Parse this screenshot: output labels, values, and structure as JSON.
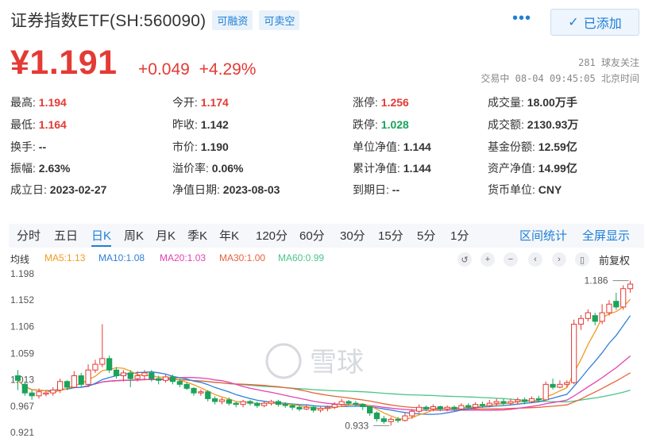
{
  "header": {
    "title": "证券指数ETF(SH:560090)",
    "tag_margin": "可融资",
    "tag_short": "可卖空",
    "more_icon": "more-dots-icon",
    "added_label": "已添加",
    "added_icon": "check-icon"
  },
  "quote": {
    "price": "¥1.191",
    "change": "+0.049",
    "change_pct": "+4.29%",
    "followers": "281 球友关注",
    "status": "交易中 08-04 09:45:05 北京时间",
    "up_color": "#e43a35",
    "down_color": "#1aa35a"
  },
  "stats": [
    {
      "k": "最高:",
      "v": "1.194",
      "c": "red"
    },
    {
      "k": "今开:",
      "v": "1.174",
      "c": "red"
    },
    {
      "k": "涨停:",
      "v": "1.256",
      "c": "red"
    },
    {
      "k": "成交量:",
      "v": "18.00万手",
      "c": ""
    },
    {
      "k": "最低:",
      "v": "1.164",
      "c": "red"
    },
    {
      "k": "昨收:",
      "v": "1.142",
      "c": ""
    },
    {
      "k": "跌停:",
      "v": "1.028",
      "c": "green"
    },
    {
      "k": "成交额:",
      "v": "2130.93万",
      "c": ""
    },
    {
      "k": "换手:",
      "v": "--",
      "c": ""
    },
    {
      "k": "市价:",
      "v": "1.190",
      "c": ""
    },
    {
      "k": "单位净值:",
      "v": "1.144",
      "c": ""
    },
    {
      "k": "基金份额:",
      "v": "12.59亿",
      "c": ""
    },
    {
      "k": "振幅:",
      "v": "2.63%",
      "c": ""
    },
    {
      "k": "溢价率:",
      "v": "0.06%",
      "c": ""
    },
    {
      "k": "累计净值:",
      "v": "1.144",
      "c": ""
    },
    {
      "k": "资产净值:",
      "v": "14.99亿",
      "c": ""
    },
    {
      "k": "成立日:",
      "v": "2023-02-27",
      "c": ""
    },
    {
      "k": "净值日期:",
      "v": "2023-08-03",
      "c": ""
    },
    {
      "k": "到期日:",
      "v": "--",
      "c": ""
    },
    {
      "k": "货币单位:",
      "v": "CNY",
      "c": ""
    }
  ],
  "tabs": [
    "分时",
    "五日",
    "日K",
    "周K",
    "月K",
    "季K",
    "年K",
    "120分",
    "60分",
    "30分",
    "15分",
    "5分",
    "1分"
  ],
  "active_tab": "日K",
  "tab_links": [
    "区间统计",
    "全屏显示"
  ],
  "ma_legend": [
    {
      "label": "均线",
      "color": "#333333"
    },
    {
      "label": "MA5:1.13",
      "color": "#f29a1f"
    },
    {
      "label": "MA10:1.08",
      "color": "#2f7fd8"
    },
    {
      "label": "MA20:1.03",
      "color": "#e443b0"
    },
    {
      "label": "MA30:1.00",
      "color": "#e8623a"
    },
    {
      "label": "MA60:0.99",
      "color": "#4cc48a"
    }
  ],
  "controls": [
    "undo-icon",
    "zoom-in-icon",
    "zoom-out-icon",
    "prev-icon",
    "next-icon",
    "candle-icon"
  ],
  "adjust_label": "前复权",
  "watermark": "雪球",
  "chart_data": {
    "type": "candlestick",
    "y_ticks": [
      "1.198",
      "1.152",
      "1.106",
      "1.059",
      "1.013",
      "0.967",
      "0.921"
    ],
    "ylim": [
      0.921,
      1.198
    ],
    "max_label": "1.186",
    "min_label": "0.933",
    "candles": [
      [
        1.02,
        1.012,
        1.03,
        0.995
      ],
      [
        1.005,
        0.99,
        1.01,
        0.985
      ],
      [
        0.99,
        0.985,
        0.995,
        0.978
      ],
      [
        0.985,
        0.992,
        0.998,
        0.98
      ],
      [
        0.988,
        0.99,
        0.995,
        0.984
      ],
      [
        0.99,
        0.995,
        1.0,
        0.985
      ],
      [
        0.995,
        1.01,
        1.015,
        0.99
      ],
      [
        1.01,
        1.0,
        1.012,
        0.995
      ],
      [
        1.0,
        1.02,
        1.028,
        0.998
      ],
      [
        1.02,
        1.005,
        1.025,
        1.0
      ],
      [
        1.005,
        1.03,
        1.04,
        1.0
      ],
      [
        1.03,
        1.04,
        1.048,
        1.025
      ],
      [
        1.04,
        1.05,
        1.11,
        1.035
      ],
      [
        1.05,
        1.03,
        1.055,
        1.025
      ],
      [
        1.03,
        1.02,
        1.035,
        1.015
      ],
      [
        1.02,
        1.025,
        1.03,
        1.01
      ],
      [
        1.025,
        1.015,
        1.03,
        1.0
      ],
      [
        1.015,
        1.02,
        1.028,
        1.01
      ],
      [
        1.02,
        1.025,
        1.03,
        1.012
      ],
      [
        1.025,
        1.015,
        1.03,
        1.01
      ],
      [
        1.015,
        1.012,
        1.02,
        1.005
      ],
      [
        1.012,
        1.018,
        1.022,
        1.008
      ],
      [
        1.018,
        1.01,
        1.022,
        1.005
      ],
      [
        1.01,
        1.005,
        1.015,
        1.0
      ],
      [
        1.005,
        0.998,
        1.008,
        0.995
      ],
      [
        0.998,
        0.99,
        1.0,
        0.985
      ],
      [
        0.99,
        0.992,
        0.996,
        0.985
      ],
      [
        0.992,
        0.98,
        0.995,
        0.975
      ],
      [
        0.98,
        0.975,
        0.984,
        0.97
      ],
      [
        0.975,
        0.978,
        0.982,
        0.97
      ],
      [
        0.978,
        0.972,
        0.982,
        0.968
      ],
      [
        0.972,
        0.97,
        0.975,
        0.965
      ],
      [
        0.97,
        0.975,
        0.978,
        0.965
      ],
      [
        0.975,
        0.972,
        0.978,
        0.968
      ],
      [
        0.972,
        0.968,
        0.975,
        0.964
      ],
      [
        0.968,
        0.972,
        0.976,
        0.965
      ],
      [
        0.972,
        0.975,
        0.978,
        0.968
      ],
      [
        0.975,
        0.97,
        0.978,
        0.966
      ],
      [
        0.97,
        0.968,
        0.974,
        0.964
      ],
      [
        0.968,
        0.965,
        0.972,
        0.96
      ],
      [
        0.965,
        0.962,
        0.968,
        0.958
      ],
      [
        0.962,
        0.965,
        0.97,
        0.96
      ],
      [
        0.965,
        0.96,
        0.968,
        0.956
      ],
      [
        0.96,
        0.963,
        0.966,
        0.956
      ],
      [
        0.963,
        0.965,
        0.968,
        0.958
      ],
      [
        0.965,
        0.97,
        0.974,
        0.962
      ],
      [
        0.97,
        0.975,
        0.98,
        0.966
      ],
      [
        0.975,
        0.972,
        0.978,
        0.968
      ],
      [
        0.972,
        0.97,
        0.976,
        0.966
      ],
      [
        0.97,
        0.966,
        0.972,
        0.96
      ],
      [
        0.966,
        0.955,
        0.968,
        0.95
      ],
      [
        0.955,
        0.945,
        0.958,
        0.94
      ],
      [
        0.945,
        0.94,
        0.95,
        0.936
      ],
      [
        0.94,
        0.944,
        0.948,
        0.933
      ],
      [
        0.944,
        0.942,
        0.948,
        0.938
      ],
      [
        0.942,
        0.95,
        0.955,
        0.94
      ],
      [
        0.95,
        0.958,
        0.962,
        0.945
      ],
      [
        0.958,
        0.965,
        0.97,
        0.955
      ],
      [
        0.965,
        0.962,
        0.968,
        0.958
      ],
      [
        0.962,
        0.966,
        0.97,
        0.958
      ],
      [
        0.966,
        0.962,
        0.968,
        0.958
      ],
      [
        0.962,
        0.965,
        0.968,
        0.958
      ],
      [
        0.965,
        0.962,
        0.968,
        0.958
      ],
      [
        0.962,
        0.968,
        0.972,
        0.96
      ],
      [
        0.968,
        0.965,
        0.972,
        0.962
      ],
      [
        0.965,
        0.97,
        0.974,
        0.962
      ],
      [
        0.97,
        0.968,
        0.975,
        0.964
      ],
      [
        0.968,
        0.972,
        0.978,
        0.965
      ],
      [
        0.972,
        0.975,
        0.98,
        0.968
      ],
      [
        0.975,
        0.972,
        0.98,
        0.968
      ],
      [
        0.972,
        0.975,
        0.98,
        0.968
      ],
      [
        0.975,
        0.978,
        0.982,
        0.97
      ],
      [
        0.978,
        0.975,
        0.982,
        0.97
      ],
      [
        0.975,
        0.98,
        0.984,
        0.972
      ],
      [
        0.98,
        0.978,
        0.985,
        0.974
      ],
      [
        0.978,
        1.005,
        1.01,
        0.976
      ],
      [
        1.005,
        1.0,
        1.015,
        0.996
      ],
      [
        1.0,
        1.005,
        1.012,
        0.998
      ],
      [
        1.005,
        1.008,
        1.012,
        1.0
      ],
      [
        1.008,
        1.11,
        1.118,
        1.005
      ],
      [
        1.11,
        1.12,
        1.126,
        1.1
      ],
      [
        1.12,
        1.13,
        1.136,
        1.115
      ],
      [
        1.125,
        1.115,
        1.13,
        1.108
      ],
      [
        1.115,
        1.13,
        1.145,
        1.11
      ],
      [
        1.13,
        1.145,
        1.152,
        1.125
      ],
      [
        1.15,
        1.14,
        1.165,
        1.135
      ],
      [
        1.14,
        1.172,
        1.178,
        1.135
      ],
      [
        1.172,
        1.18,
        1.186,
        1.165
      ]
    ]
  }
}
